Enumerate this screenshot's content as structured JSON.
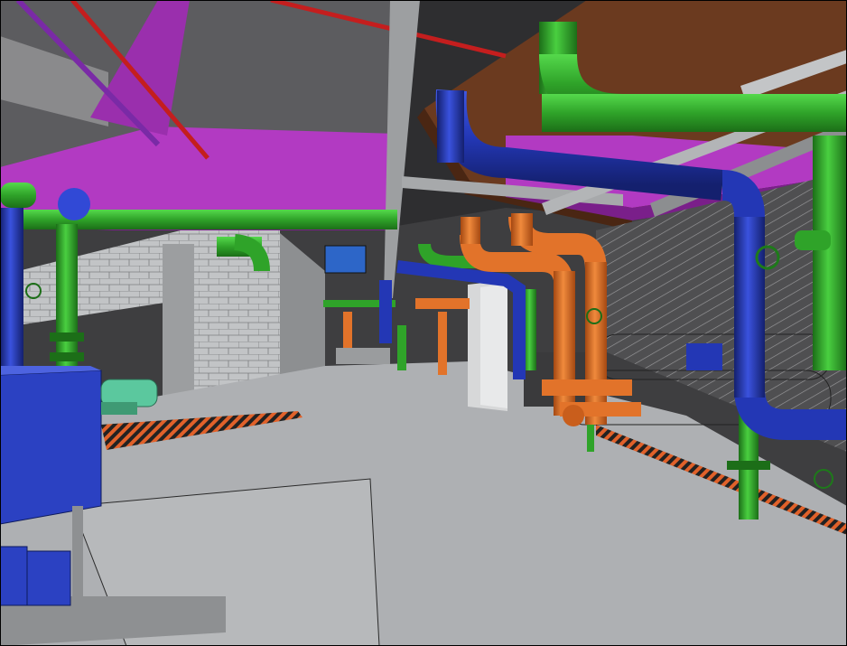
{
  "view": {
    "kind": "3d-bim-mechanical-room-render",
    "colors": {
      "background": "#ffffff",
      "floor": "#aeb0b3",
      "floor_dark": "#8e9092",
      "ceiling": "#3e3e40",
      "ceiling_slab": "#6d6d70",
      "wall_brick": "#bdbfc1",
      "wall_right": "#6c6c6e",
      "hatched_wall": "#5a5a5c",
      "duct_magenta": "#b23ac2",
      "duct_magenta_dark": "#7a1f8a",
      "duct_brown": "#6b3a1f",
      "pipe_green": "#2fa329",
      "pipe_green_light": "#3bc233",
      "pipe_blue": "#2337b5",
      "pipe_blue_light": "#3149d6",
      "pipe_orange": "#e2732a",
      "pipe_red": "#c41e1e",
      "equipment_blue": "#2b41c2",
      "chiller_gray": "#8f9194",
      "pump_teal": "#5bc89e",
      "safety_stripe": "#d65a1f",
      "column": "#d7d8d9"
    },
    "elements": [
      {
        "name": "ceiling-slab"
      },
      {
        "name": "magenta-air-duct"
      },
      {
        "name": "brown-air-duct"
      },
      {
        "name": "red-sprinkler-pipe"
      },
      {
        "name": "green-pipe-run"
      },
      {
        "name": "blue-pipe-run"
      },
      {
        "name": "orange-pipe-run"
      },
      {
        "name": "chiller-units"
      },
      {
        "name": "blue-equipment-cabinet"
      },
      {
        "name": "teal-pump"
      },
      {
        "name": "brick-wall"
      },
      {
        "name": "hatched-wall"
      },
      {
        "name": "concrete-column"
      },
      {
        "name": "floor"
      }
    ]
  }
}
